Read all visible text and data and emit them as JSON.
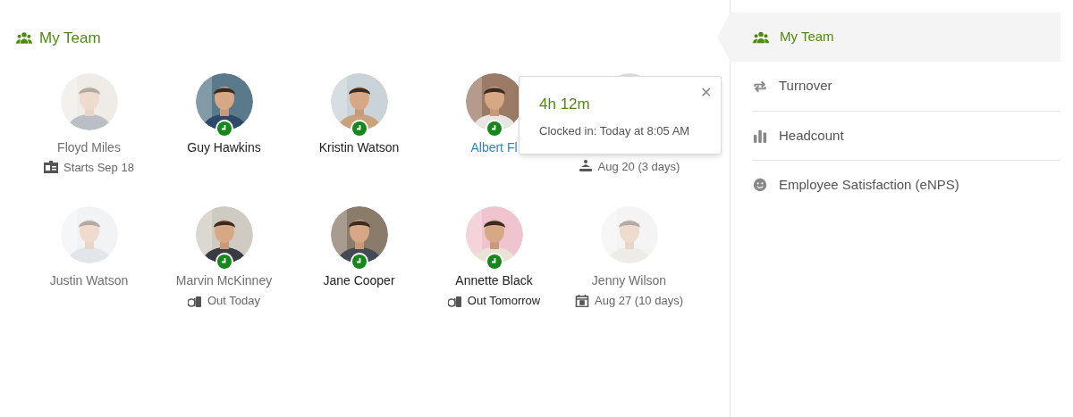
{
  "header": {
    "title": "My Team"
  },
  "members": [
    {
      "name": "Floyd Miles",
      "faded": true,
      "away": true,
      "clocked_in": false,
      "highlighted": false,
      "note": {
        "kind": "badge",
        "text": "Starts Sep 18"
      }
    },
    {
      "name": "Guy Hawkins",
      "faded": false,
      "away": false,
      "clocked_in": true,
      "highlighted": false
    },
    {
      "name": "Kristin Watson",
      "faded": false,
      "away": false,
      "clocked_in": true,
      "highlighted": false
    },
    {
      "name": "Albert Fl",
      "faded": false,
      "clocked_in": true,
      "highlighted": true
    },
    {
      "away": true,
      "note": {
        "kind": "vacation",
        "text": "Aug 20 (3 days)"
      }
    },
    {
      "name": "Justin Watson",
      "faded": true,
      "away": true,
      "clocked_in": false,
      "highlighted": false
    },
    {
      "name": "Marvin McKinney",
      "faded": false,
      "away": true,
      "clocked_in": true,
      "highlighted": false,
      "note": {
        "kind": "out",
        "text": "Out Today"
      }
    },
    {
      "name": "Jane Cooper",
      "faded": false,
      "away": false,
      "clocked_in": true,
      "highlighted": false
    },
    {
      "name": "Annette Black",
      "faded": false,
      "away": false,
      "clocked_in": true,
      "highlighted": false,
      "note": {
        "kind": "out",
        "text": "Out Tomorrow"
      }
    },
    {
      "name": "Jenny Wilson",
      "faded": true,
      "away": true,
      "clocked_in": false,
      "highlighted": false,
      "note": {
        "kind": "calendar",
        "text": "Aug 27 (10 days)"
      }
    }
  ],
  "popover": {
    "title": "4h 12m",
    "text": "Clocked in: Today at 8:05 AM",
    "close": "✕"
  },
  "sidebar": {
    "items": [
      {
        "kind": "team",
        "label": "My Team",
        "selected": true
      },
      {
        "kind": "turnover",
        "label": "Turnover",
        "selected": false
      },
      {
        "kind": "headcount",
        "label": "Headcount",
        "selected": false
      },
      {
        "kind": "satisfaction",
        "label": "Employee Satisfaction (eNPS)",
        "selected": false
      }
    ]
  }
}
